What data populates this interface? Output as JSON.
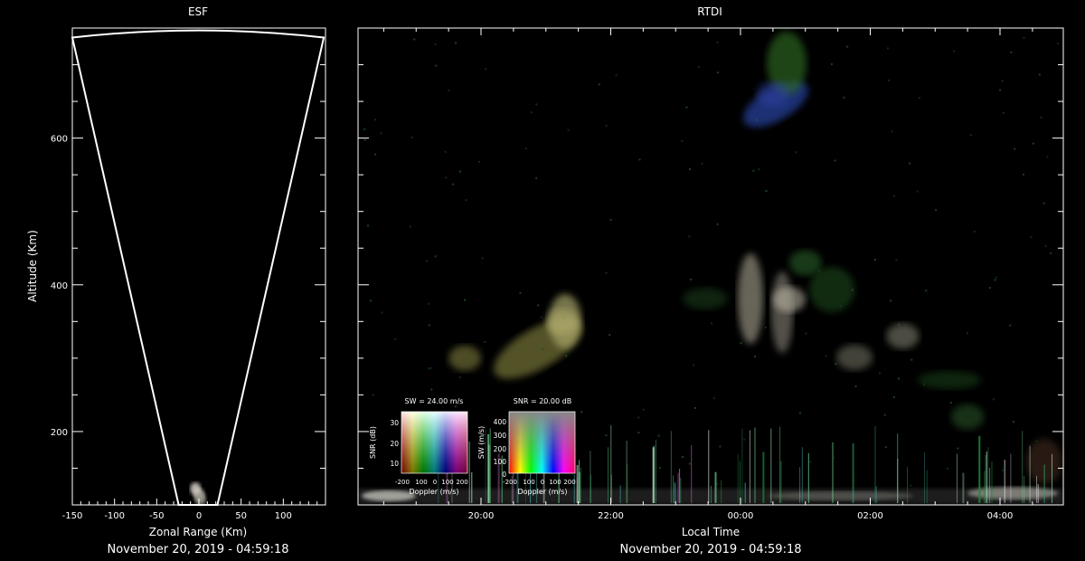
{
  "chart_data": [
    {
      "type": "scatter",
      "title": "ESF",
      "xlabel": "Zonal Range (Km)",
      "ylabel": "Altitude (Km)",
      "xlim": [
        -150,
        150
      ],
      "ylim": [
        100,
        750
      ],
      "x_ticks": [
        -150,
        -100,
        -50,
        0,
        50,
        100
      ],
      "y_ticks": [
        200,
        400,
        600
      ],
      "fan_outline": {
        "left_edge": [
          [
            -150,
            737
          ],
          [
            -24,
            100
          ]
        ],
        "right_edge": [
          [
            148,
            737
          ],
          [
            22,
            100
          ]
        ],
        "top_arc": [
          [
            -150,
            737
          ],
          [
            -50,
            750
          ],
          [
            0,
            752
          ],
          [
            50,
            750
          ],
          [
            148,
            737
          ]
        ]
      },
      "echo_clusters": [
        {
          "x": 0,
          "y": 114,
          "color": "#bdb9b2"
        },
        {
          "x": -4,
          "y": 122,
          "color": "#d6d0c8"
        },
        {
          "x": 2,
          "y": 108,
          "color": "#9c978e"
        }
      ],
      "footer": "November 20, 2019 - 04:59:18"
    },
    {
      "type": "heatmap",
      "title": "RTDI",
      "xlabel": "Local Time",
      "x_ticks": [
        "20:00",
        "22:00",
        "00:00",
        "02:00",
        "04:00"
      ],
      "y_ticks": [
        200,
        400,
        600
      ],
      "ylim": [
        100,
        750
      ],
      "echo_regions": [
        {
          "x": "19:45",
          "y": 300,
          "color": "#8c8a45"
        },
        {
          "x": "21:15",
          "y": 350,
          "color": "#b5b070"
        },
        {
          "x": "00:30",
          "y": 660,
          "color": "#2f3fa0"
        },
        {
          "x": "00:45",
          "y": 380,
          "color": "#c8c2b0"
        },
        {
          "x": "01:00",
          "y": 430,
          "color": "#2e6a2e"
        },
        {
          "x": "02:30",
          "y": 330,
          "color": "#8a8a78"
        },
        {
          "x": "03:30",
          "y": 220,
          "color": "#2a5a2a"
        }
      ],
      "footer": "November 20, 2019 - 04:59:18"
    }
  ],
  "legends": {
    "sw_legend": {
      "title": "SW = 24.00 m/s",
      "ylabel": "SNR (dB)",
      "xlabel": "Doppler (m/s)",
      "y_ticks": [
        "30",
        "20",
        "10"
      ],
      "x_ticks": [
        "-200",
        "100",
        "0",
        "100",
        "200"
      ]
    },
    "snr_legend": {
      "title": "SNR = 20.00 dB",
      "ylabel": "SW (m/s)",
      "xlabel": "Doppler (m/s)",
      "y_ticks": [
        "400",
        "300",
        "200",
        "100",
        "0"
      ],
      "x_ticks": [
        "-200",
        "100",
        "0",
        "100",
        "200"
      ]
    }
  }
}
